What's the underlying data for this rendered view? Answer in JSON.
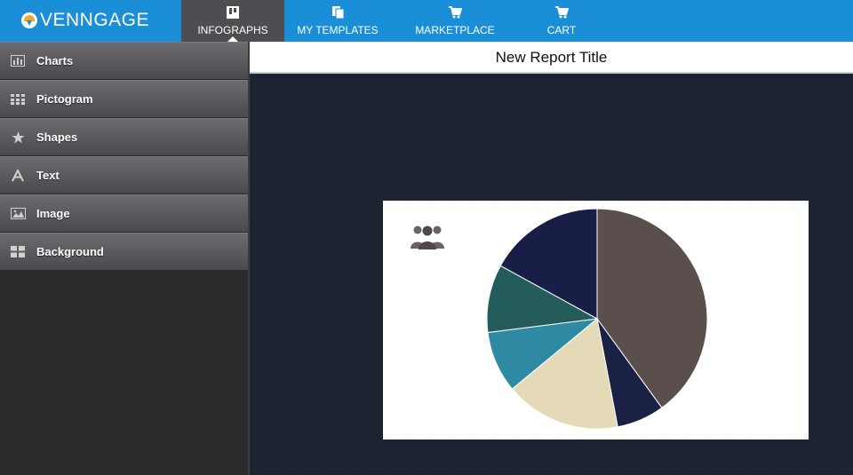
{
  "brand": {
    "name": "VENNGAGE"
  },
  "nav": {
    "items": [
      {
        "label": "INFOGRAPHS",
        "icon": "infographs-icon"
      },
      {
        "label": "MY TEMPLATES",
        "icon": "templates-icon"
      },
      {
        "label": "MARKETPLACE",
        "icon": "cart-icon"
      },
      {
        "label": "CART",
        "icon": "cart-icon"
      }
    ]
  },
  "sidebar": {
    "items": [
      {
        "label": "Charts",
        "icon": "bar-chart-icon"
      },
      {
        "label": "Pictogram",
        "icon": "grid-icon"
      },
      {
        "label": "Shapes",
        "icon": "star-icon"
      },
      {
        "label": "Text",
        "icon": "text-icon"
      },
      {
        "label": "Image",
        "icon": "image-icon"
      },
      {
        "label": "Background",
        "icon": "tiles-icon"
      }
    ]
  },
  "report": {
    "title": "New Report Title"
  },
  "chart_data": {
    "type": "pie",
    "values": [
      40,
      7,
      17,
      9,
      10,
      17
    ],
    "colors": [
      "#5a4f4d",
      "#1b2145",
      "#e4dab7",
      "#2e8aa3",
      "#245c5b",
      "#191e47"
    ]
  },
  "colors": {
    "accent": "#1a8fd8",
    "active_tab": "#4e4e52"
  }
}
